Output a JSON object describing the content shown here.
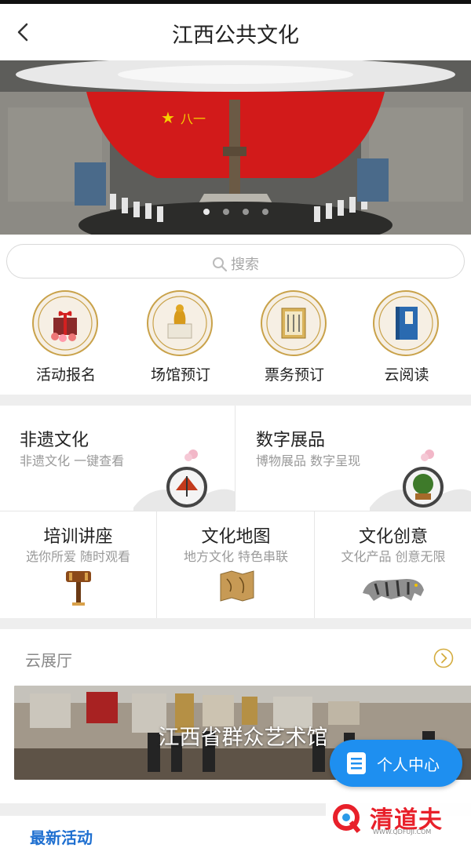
{
  "header": {
    "title": "江西公共文化"
  },
  "search": {
    "placeholder": "搜索"
  },
  "quick_links": [
    {
      "label": "活动报名",
      "icon": "gift-icon"
    },
    {
      "label": "场馆预订",
      "icon": "museum-icon"
    },
    {
      "label": "票务预订",
      "icon": "ticket-icon"
    },
    {
      "label": "云阅读",
      "icon": "book-icon"
    }
  ],
  "features": [
    {
      "title": "非遗文化",
      "subtitle": "非遗文化 一键查看",
      "icon": "fan-icon"
    },
    {
      "title": "数字展品",
      "subtitle": "博物展品 数字呈现",
      "icon": "bonsai-icon"
    },
    {
      "title": "培训讲座",
      "subtitle": "选你所爱 随时观看",
      "icon": "gavel-icon"
    },
    {
      "title": "文化地图",
      "subtitle": "地方文化 特色串联",
      "icon": "map-icon"
    },
    {
      "title": "文化创意",
      "subtitle": "文化产品 创意无限",
      "icon": "tiger-icon"
    }
  ],
  "cloud_hall": {
    "title": "云展厅",
    "venue": "江西省群众艺术馆"
  },
  "fab": {
    "label": "个人中心"
  },
  "latest": {
    "title": "最新活动"
  },
  "watermark": {
    "brand": "清道夫",
    "site": "WWW.QDFUJI.COM"
  },
  "colors": {
    "accent": "#1e8ff0",
    "gold": "#c9a24a",
    "red": "#d42020"
  }
}
